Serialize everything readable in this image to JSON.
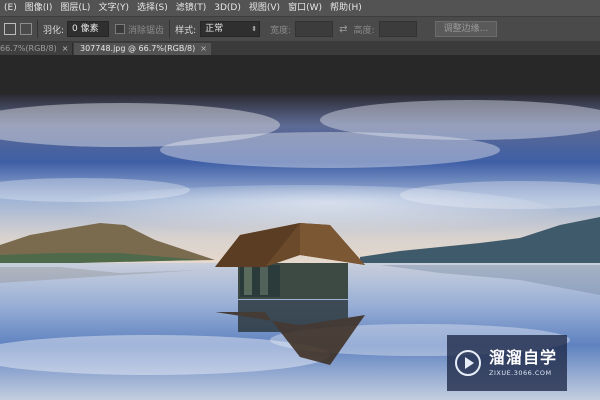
{
  "menubar": {
    "items": [
      "(E)",
      "图像(I)",
      "图层(L)",
      "文字(Y)",
      "选择(S)",
      "滤镜(T)",
      "3D(D)",
      "视图(V)",
      "窗口(W)",
      "帮助(H)"
    ]
  },
  "options": {
    "feather_label": "羽化:",
    "feather_value": "0 像素",
    "antialias_label": "消除锯齿",
    "style_label": "样式:",
    "style_value": "正常",
    "width_label": "宽度:",
    "height_label": "高度:",
    "refine_edge": "调整边缘..."
  },
  "tabs": [
    {
      "label": "66.7%(RGB/8)",
      "close": "×",
      "active": false
    },
    {
      "label": "307748.jpg @ 66.7%(RGB/8)",
      "close": "×",
      "active": true
    }
  ],
  "watermark": {
    "title": "溜溜自学",
    "url": "ZIXUE.3066.COM"
  },
  "colors": {
    "menubar_bg": "#535353",
    "options_bg": "#4a4a4a",
    "workspace_bg": "#282828"
  },
  "icons": [
    "selection-add-icon",
    "selection-subtract-icon",
    "swap-icon",
    "watermark-play-icon",
    "dropdown-arrow-icon"
  ]
}
